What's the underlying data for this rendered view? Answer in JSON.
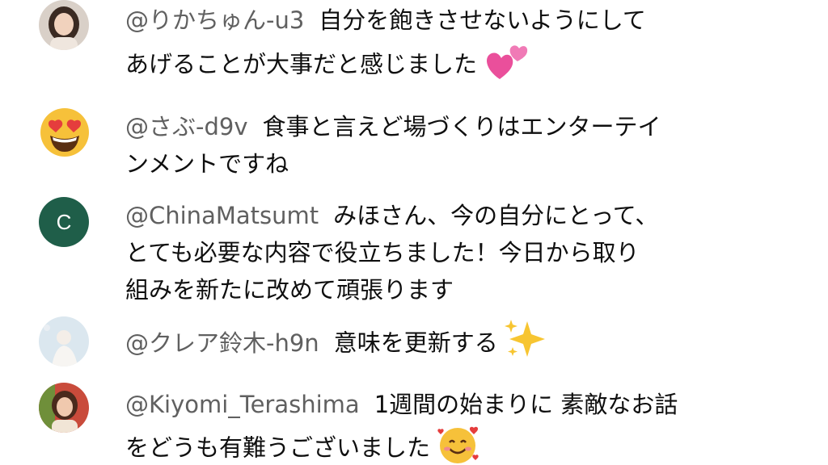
{
  "comments": [
    {
      "handle": "@りかちゅん-u3",
      "line1": "自分を飽きさせないようにして",
      "line2": "あげることが大事だと感じました",
      "emoji_icon": "two-hearts-icon"
    },
    {
      "handle": "@さぶ-d9v",
      "line1": "食事と言えど場づくりはエンターテイ",
      "line2": "ンメントですね",
      "avatar_icon": "heart-eyes-emoji-icon"
    },
    {
      "handle": "@ChinaMatsumt",
      "line1": "みほさん、今の自分にとって、",
      "line2": "とても必要な内容で役立ちました！今日から取り",
      "line3": "組みを新たに改めて頑張ります",
      "avatar_letter": "C",
      "avatar_color": "#1f5e49"
    },
    {
      "handle": "@クレア鈴木-h9n",
      "line1": "意味を更新する",
      "emoji_icon": "sparkles-icon"
    },
    {
      "handle": "@Kiyomi_Terashima",
      "line1": "1週間の始まりに 素敵なお話",
      "line2": "をどうも有難うございました",
      "emoji_icon": "smiling-face-with-hearts-icon"
    }
  ]
}
